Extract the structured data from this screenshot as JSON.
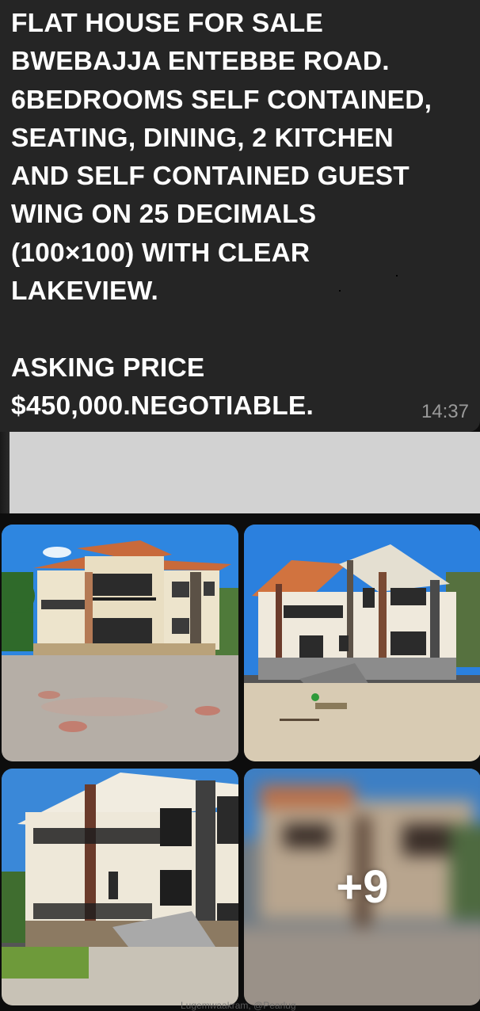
{
  "message": {
    "text": "FLAT HOUSE FOR SALE\nBWEBAJJA ENTEBBE ROAD.\n6BEDROOMS SELF CONTAINED,\nSEATING, DINING, 2 KITCHEN\nAND SELF CONTAINED GUEST\nWING ON 25 DECIMALS\n(100×100) WITH CLEAR\nLAKEVIEW.\n\nASKING PRICE\n$450,000.NEGOTIABLE.",
    "time": "14:37"
  },
  "gallery": {
    "photos": [
      {
        "alt": "house-photo"
      },
      {
        "alt": "house-photo"
      },
      {
        "alt": "house-photo"
      },
      {
        "alt": "house-photo"
      }
    ],
    "more_count": "+9"
  },
  "watermark": "Lugemwaakram, @Pearlug",
  "colors": {
    "bubble": "#252525",
    "background": "#0d0d0d",
    "timestamp": "#9a9a9a",
    "roof": "#c9663a",
    "wall": "#e9e2cf",
    "sky": "#3a86d6"
  }
}
